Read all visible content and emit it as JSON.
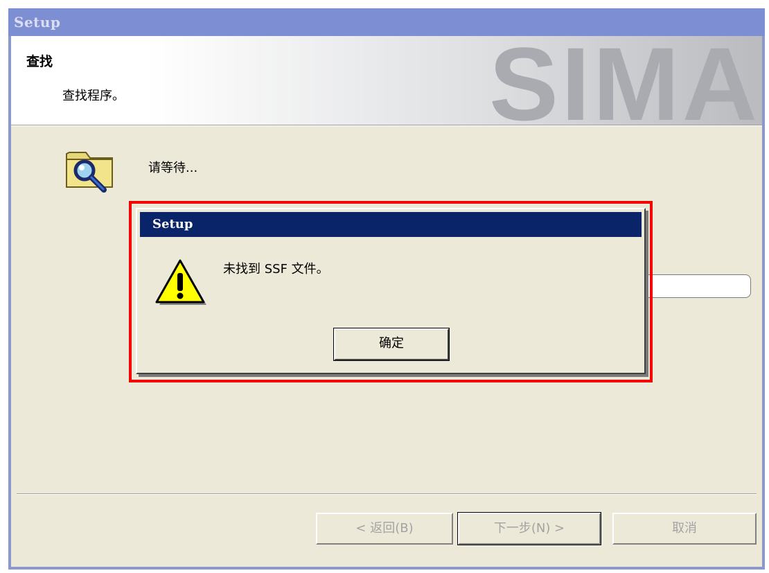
{
  "window": {
    "title": "Setup"
  },
  "banner": {
    "heading": "查找",
    "subtitle": "查找程序。",
    "watermark": "SIMA"
  },
  "main": {
    "status_text": "请等待..."
  },
  "buttons": {
    "back": "< 返回(B)",
    "next": "下一步(N) >",
    "cancel": "取消"
  },
  "dialog": {
    "title": "Setup",
    "message": "未找到 SSF 文件。",
    "ok": "确定",
    "icon": "warning-icon"
  },
  "colors": {
    "highlight": "#f40000",
    "dialog_title_bar": "#0a246a",
    "window_title_bar": "#7d8fd2",
    "face": "#ece9d8"
  }
}
